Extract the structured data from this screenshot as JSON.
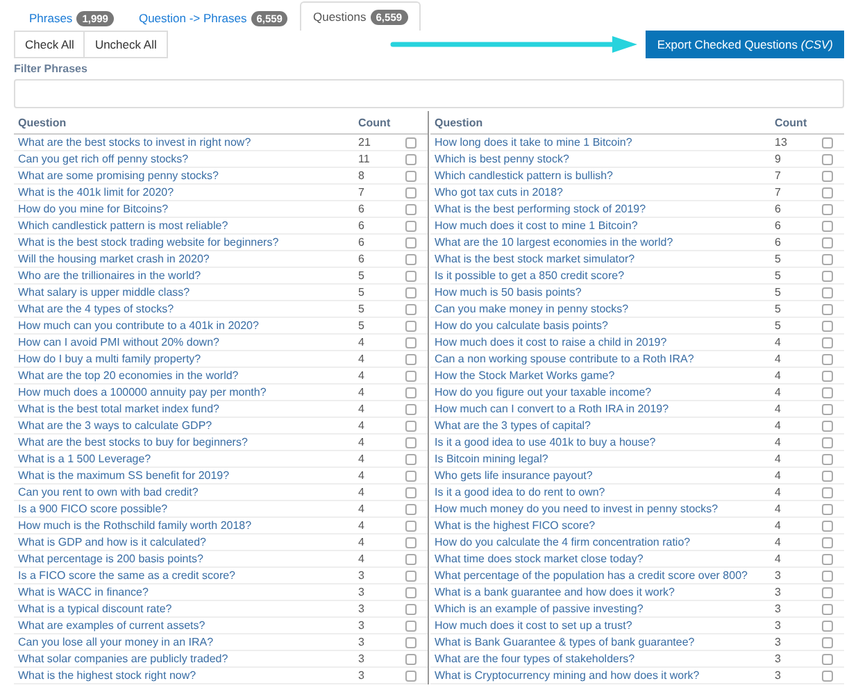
{
  "tabs": [
    {
      "label": "Phrases",
      "count": "1,999",
      "selected": false
    },
    {
      "label": "Question -> Phrases",
      "count": "6,559",
      "selected": false
    },
    {
      "label": "Questions",
      "count": "6,559",
      "selected": true
    }
  ],
  "buttons": {
    "check_all": "Check All",
    "uncheck_all": "Uncheck All",
    "export": "Export Checked Questions *(CSV)*"
  },
  "filter": {
    "label": "Filter Phrases"
  },
  "tables": [
    {
      "columns": [
        "Question",
        "Count"
      ],
      "rows": [
        {
          "question": "What are the best stocks to invest in right now?",
          "count": "21",
          "checked": false
        },
        {
          "question": "Can you get rich off penny stocks?",
          "count": "11",
          "checked": false
        },
        {
          "question": "What are some promising penny stocks?",
          "count": "8",
          "checked": false
        },
        {
          "question": "What is the 401k limit for 2020?",
          "count": "7",
          "checked": false
        },
        {
          "question": "How do you mine for Bitcoins?",
          "count": "6",
          "checked": false
        },
        {
          "question": "Which candlestick pattern is most reliable?",
          "count": "6",
          "checked": false
        },
        {
          "question": "What is the best stock trading website for beginners?",
          "count": "6",
          "checked": false
        },
        {
          "question": "Will the housing market crash in 2020?",
          "count": "6",
          "checked": false
        },
        {
          "question": "Who are the trillionaires in the world?",
          "count": "5",
          "checked": false
        },
        {
          "question": "What salary is upper middle class?",
          "count": "5",
          "checked": false
        },
        {
          "question": "What are the 4 types of stocks?",
          "count": "5",
          "checked": false
        },
        {
          "question": "How much can you contribute to a 401k in 2020?",
          "count": "5",
          "checked": false
        },
        {
          "question": "How can I avoid PMI without 20% down?",
          "count": "4",
          "checked": false
        },
        {
          "question": "How do I buy a multi family property?",
          "count": "4",
          "checked": false
        },
        {
          "question": "What are the top 20 economies in the world?",
          "count": "4",
          "checked": false
        },
        {
          "question": "How much does a 100000 annuity pay per month?",
          "count": "4",
          "checked": false
        },
        {
          "question": "What is the best total market index fund?",
          "count": "4",
          "checked": false
        },
        {
          "question": "What are the 3 ways to calculate GDP?",
          "count": "4",
          "checked": false
        },
        {
          "question": "What are the best stocks to buy for beginners?",
          "count": "4",
          "checked": false
        },
        {
          "question": "What is a 1 500 Leverage?",
          "count": "4",
          "checked": false
        },
        {
          "question": "What is the maximum SS benefit for 2019?",
          "count": "4",
          "checked": false
        },
        {
          "question": "Can you rent to own with bad credit?",
          "count": "4",
          "checked": false
        },
        {
          "question": "Is a 900 FICO score possible?",
          "count": "4",
          "checked": false
        },
        {
          "question": "How much is the Rothschild family worth 2018?",
          "count": "4",
          "checked": false
        },
        {
          "question": "What is GDP and how is it calculated?",
          "count": "4",
          "checked": false
        },
        {
          "question": "What percentage is 200 basis points?",
          "count": "4",
          "checked": false
        },
        {
          "question": "Is a FICO score the same as a credit score?",
          "count": "3",
          "checked": false
        },
        {
          "question": "What is WACC in finance?",
          "count": "3",
          "checked": false
        },
        {
          "question": "What is a typical discount rate?",
          "count": "3",
          "checked": false
        },
        {
          "question": "What are examples of current assets?",
          "count": "3",
          "checked": false
        },
        {
          "question": "Can you lose all your money in an IRA?",
          "count": "3",
          "checked": false
        },
        {
          "question": "What solar companies are publicly traded?",
          "count": "3",
          "checked": false
        },
        {
          "question": "What is the highest stock right now?",
          "count": "3",
          "checked": false
        }
      ]
    },
    {
      "columns": [
        "Question",
        "Count"
      ],
      "rows": [
        {
          "question": "How long does it take to mine 1 Bitcoin?",
          "count": "13",
          "checked": false
        },
        {
          "question": "Which is best penny stock?",
          "count": "9",
          "checked": false
        },
        {
          "question": "Which candlestick pattern is bullish?",
          "count": "7",
          "checked": false
        },
        {
          "question": "Who got tax cuts in 2018?",
          "count": "7",
          "checked": false
        },
        {
          "question": "What is the best performing stock of 2019?",
          "count": "6",
          "checked": false
        },
        {
          "question": "How much does it cost to mine 1 Bitcoin?",
          "count": "6",
          "checked": false
        },
        {
          "question": "What are the 10 largest economies in the world?",
          "count": "6",
          "checked": false
        },
        {
          "question": "What is the best stock market simulator?",
          "count": "5",
          "checked": false
        },
        {
          "question": "Is it possible to get a 850 credit score?",
          "count": "5",
          "checked": false
        },
        {
          "question": "How much is 50 basis points?",
          "count": "5",
          "checked": false
        },
        {
          "question": "Can you make money in penny stocks?",
          "count": "5",
          "checked": false
        },
        {
          "question": "How do you calculate basis points?",
          "count": "5",
          "checked": false
        },
        {
          "question": "How much does it cost to raise a child in 2019?",
          "count": "4",
          "checked": false
        },
        {
          "question": "Can a non working spouse contribute to a Roth IRA?",
          "count": "4",
          "checked": false
        },
        {
          "question": "How the Stock Market Works game?",
          "count": "4",
          "checked": false
        },
        {
          "question": "How do you figure out your taxable income?",
          "count": "4",
          "checked": false
        },
        {
          "question": "How much can I convert to a Roth IRA in 2019?",
          "count": "4",
          "checked": false
        },
        {
          "question": "What are the 3 types of capital?",
          "count": "4",
          "checked": false
        },
        {
          "question": "Is it a good idea to use 401k to buy a house?",
          "count": "4",
          "checked": false
        },
        {
          "question": "Is Bitcoin mining legal?",
          "count": "4",
          "checked": false
        },
        {
          "question": "Who gets life insurance payout?",
          "count": "4",
          "checked": false
        },
        {
          "question": "Is it a good idea to do rent to own?",
          "count": "4",
          "checked": false
        },
        {
          "question": "How much money do you need to invest in penny stocks?",
          "count": "4",
          "checked": false
        },
        {
          "question": "What is the highest FICO score?",
          "count": "4",
          "checked": false
        },
        {
          "question": "How do you calculate the 4 firm concentration ratio?",
          "count": "4",
          "checked": false
        },
        {
          "question": "What time does stock market close today?",
          "count": "4",
          "checked": false
        },
        {
          "question": "What percentage of the population has a credit score over 800?",
          "count": "3",
          "checked": false
        },
        {
          "question": "What is a bank guarantee and how does it work?",
          "count": "3",
          "checked": false
        },
        {
          "question": "Which is an example of passive investing?",
          "count": "3",
          "checked": false
        },
        {
          "question": "How much does it cost to set up a trust?",
          "count": "3",
          "checked": false
        },
        {
          "question": "What is Bank Guarantee & types of bank guarantee?",
          "count": "3",
          "checked": false
        },
        {
          "question": "What are the four types of stakeholders?",
          "count": "3",
          "checked": false
        },
        {
          "question": "What is Cryptocurrency mining and how does it work?",
          "count": "3",
          "checked": false
        }
      ]
    }
  ]
}
